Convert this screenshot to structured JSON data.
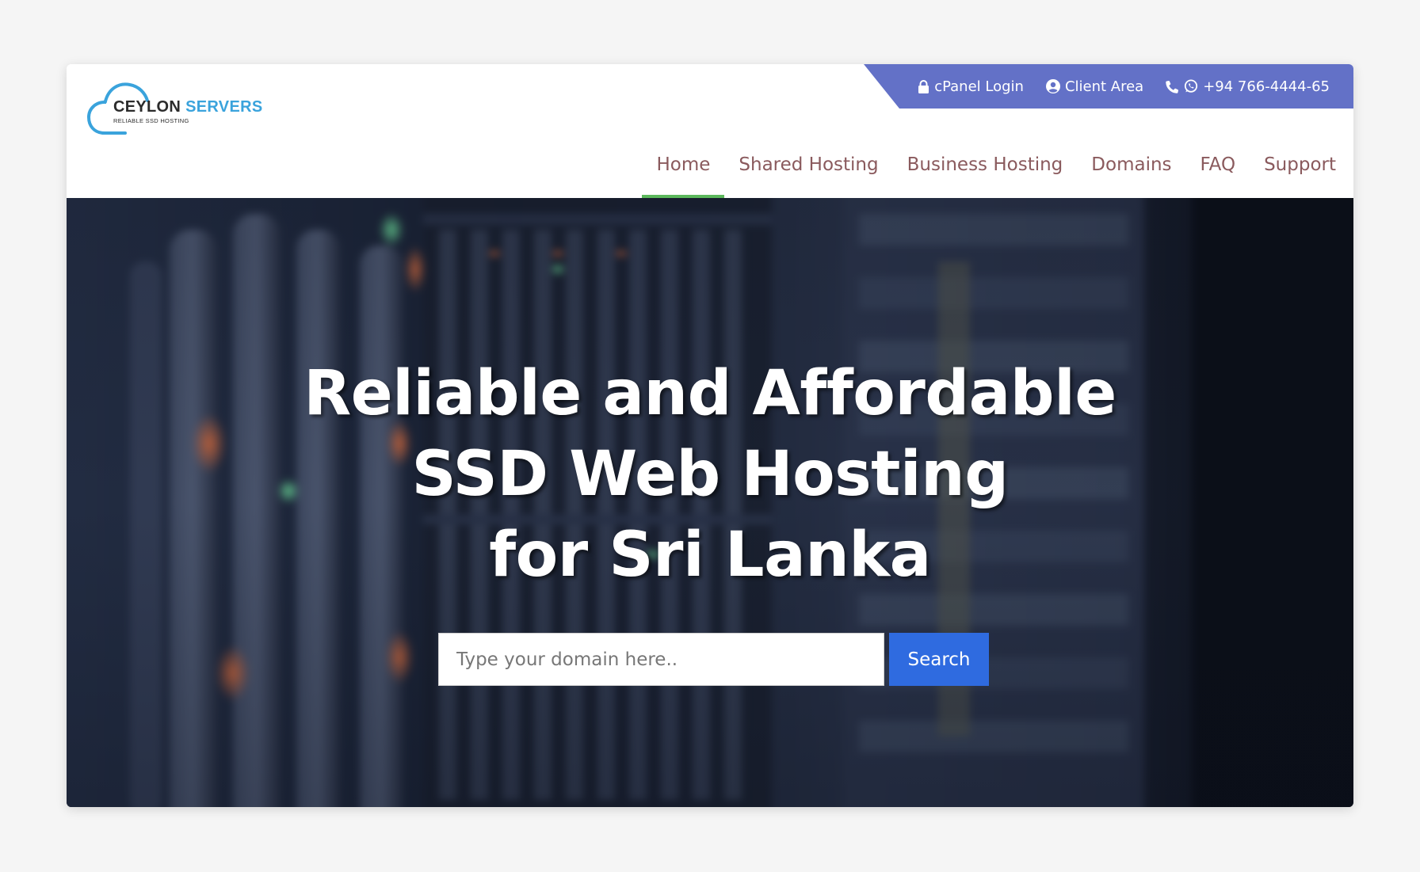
{
  "brand": {
    "name_part1": "CEYLON",
    "name_part2": "SERVERS",
    "tagline": "RELIABLE SSD HOSTING"
  },
  "topbar": {
    "cpanel_label": "cPanel Login",
    "client_area_label": "Client Area",
    "phone": "+94 766-4444-65"
  },
  "nav": {
    "items": [
      {
        "label": "Home",
        "active": true
      },
      {
        "label": "Shared Hosting",
        "active": false
      },
      {
        "label": "Business Hosting",
        "active": false
      },
      {
        "label": "Domains",
        "active": false
      },
      {
        "label": "FAQ",
        "active": false
      },
      {
        "label": "Support",
        "active": false
      }
    ]
  },
  "hero": {
    "title_line1": "Reliable and Affordable",
    "title_line2": "SSD Web Hosting",
    "title_line3": "for Sri Lanka"
  },
  "search": {
    "placeholder": "Type your domain here..",
    "value": "",
    "button_label": "Search"
  },
  "colors": {
    "topbar_bg": "#6371c7",
    "nav_text": "#8a5a5d",
    "nav_active_underline": "#5cb85c",
    "search_button": "#2f6be0",
    "brand_blue": "#3aa3dc"
  }
}
